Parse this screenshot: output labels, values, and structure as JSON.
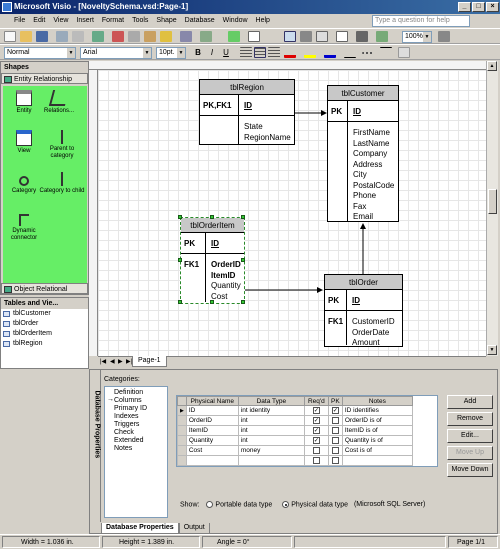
{
  "window": {
    "title": "Microsoft Visio - [NoveltySchema.vsd:Page-1]",
    "min": "_",
    "max": "□",
    "close": "×"
  },
  "menu": [
    "File",
    "Edit",
    "View",
    "Insert",
    "Format",
    "Tools",
    "Shape",
    "Database",
    "Window",
    "Help"
  ],
  "help_placeholder": "Type a question for help",
  "toolbar": {
    "style": "Normal",
    "font": "Arial",
    "size": "10pt.",
    "zoom": "100%",
    "bold": "B",
    "italic": "I",
    "underline": "U"
  },
  "shapes_panel": {
    "title": "Shapes",
    "stencil": "Entity Relationship",
    "items": [
      "Entity",
      "Relations...",
      "View",
      "Parent to category",
      "Category",
      "Category to child",
      "Dynamic connector"
    ],
    "stencil2": "Object Relational"
  },
  "tables_panel": {
    "title": "Tables and Vie...",
    "items": [
      "tblCustomer",
      "tblOrder",
      "tblOrderItem",
      "tblRegion"
    ]
  },
  "entities": {
    "region": {
      "name": "tblRegion",
      "pk_label": "PK,FK1",
      "pk": "ID",
      "cols": [
        "State",
        "RegionName"
      ]
    },
    "customer": {
      "name": "tblCustomer",
      "pk_label": "PK",
      "pk": "ID",
      "cols": [
        "FirstName",
        "LastName",
        "Company",
        "Address",
        "City",
        "PostalCode",
        "Phone",
        "Fax",
        "Email"
      ]
    },
    "orderitem": {
      "name": "tblOrderItem",
      "pk_label": "PK",
      "pk": "ID",
      "fk_label": "FK1",
      "cols_bold": [
        "OrderID",
        "ItemID"
      ],
      "cols": [
        "Quantity",
        "Cost"
      ]
    },
    "order": {
      "name": "tblOrder",
      "pk_label": "PK",
      "pk": "ID",
      "fk_label": "FK1",
      "cols": [
        "CustomerID",
        "OrderDate",
        "Amount"
      ]
    }
  },
  "page_tab": "Page-1",
  "db_properties": {
    "side_title": "Database Properties",
    "categories_label": "Categories:",
    "categories": [
      "Definition",
      "Columns",
      "Primary ID",
      "Indexes",
      "Triggers",
      "Check",
      "Extended",
      "Notes"
    ],
    "selected_category": "Columns",
    "columns_headers": [
      "Physical Name",
      "Data Type",
      "Req'd",
      "PK",
      "Notes"
    ],
    "rows": [
      {
        "name": "ID",
        "type": "int identity",
        "req": true,
        "pk": true,
        "notes": "ID identifies"
      },
      {
        "name": "OrderID",
        "type": "int",
        "req": true,
        "pk": false,
        "notes": "OrderID is of"
      },
      {
        "name": "ItemID",
        "type": "int",
        "req": true,
        "pk": false,
        "notes": "ItemID is of"
      },
      {
        "name": "Quantity",
        "type": "int",
        "req": true,
        "pk": false,
        "notes": "Quantity is of"
      },
      {
        "name": "Cost",
        "type": "money",
        "req": false,
        "pk": false,
        "notes": "Cost is of"
      }
    ],
    "buttons": [
      "Add",
      "Remove",
      "Edit...",
      "Move Up",
      "Move Down"
    ],
    "show_label": "Show:",
    "portable": "Portable data type",
    "physical": "Physical data type",
    "sql_server": "(Microsoft SQL Server)",
    "tabs": [
      "Database Properties",
      "Output"
    ]
  },
  "status": {
    "width": "Width = 1.036 in.",
    "height": "Height = 1.389 in.",
    "angle": "Angle = 0°",
    "page": "Page 1/1"
  },
  "colors": {
    "stencil_bg": "#66ee66",
    "titlebar": "#0a246a",
    "selection": "#2a8a2a"
  }
}
